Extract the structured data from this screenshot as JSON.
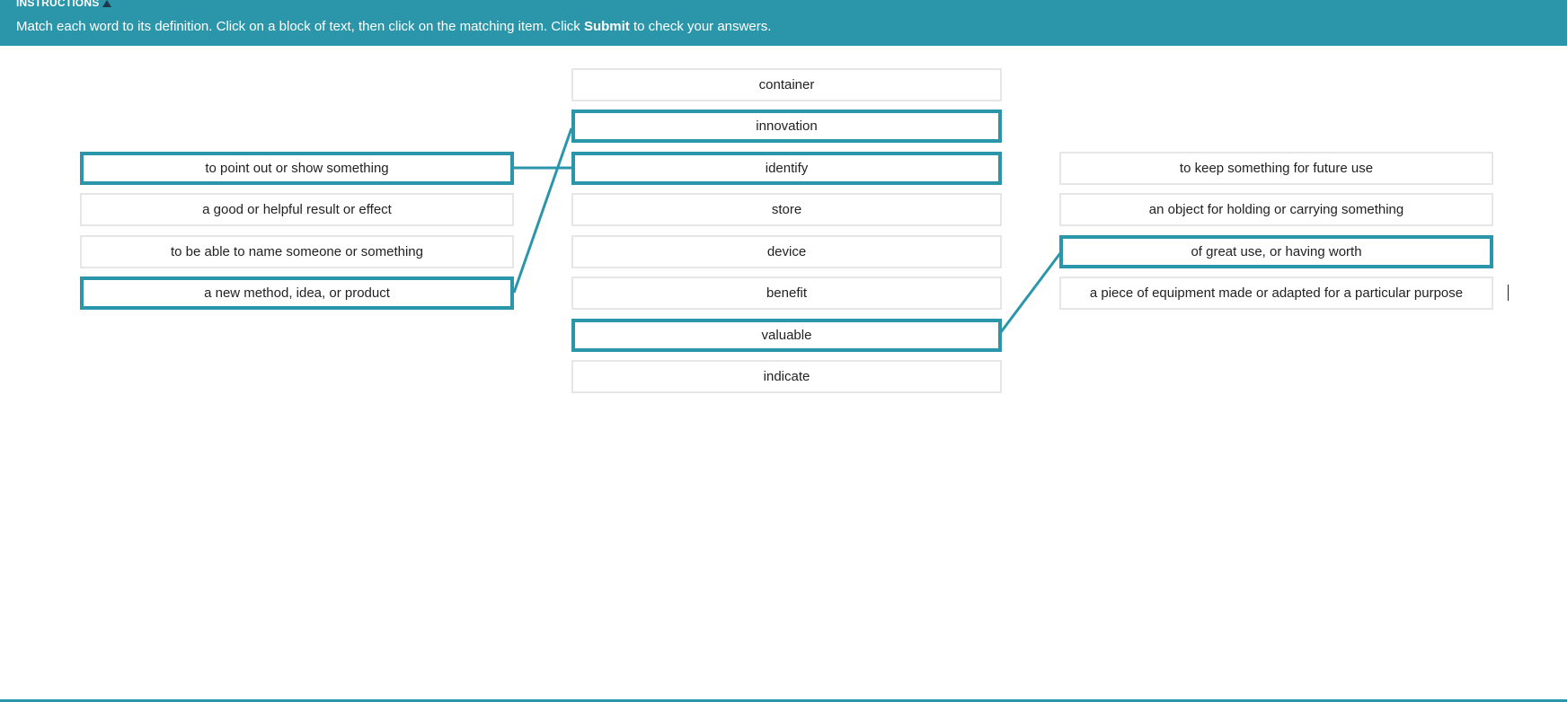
{
  "header": {
    "title": "INSTRUCTIONS",
    "toggle_icon": "triangle-up-icon",
    "instruction_before": "Match each word to its definition. Click on a block of text, then click on the matching item. Click ",
    "instruction_bold": "Submit",
    "instruction_after": " to check your answers."
  },
  "colors": {
    "accent": "#2b96a9",
    "box_border": "#e6e6e6",
    "toggle_icon": "#1b3a48"
  },
  "left_definitions": [
    {
      "text": "to point out or show something",
      "selected": true
    },
    {
      "text": "a good or helpful result or effect",
      "selected": false
    },
    {
      "text": "to be able to name someone or something",
      "selected": false
    },
    {
      "text": "a new method, idea, or product",
      "selected": true
    }
  ],
  "words": [
    {
      "text": "container",
      "selected": false
    },
    {
      "text": "innovation",
      "selected": true
    },
    {
      "text": "identify",
      "selected": true
    },
    {
      "text": "store",
      "selected": false
    },
    {
      "text": "device",
      "selected": false
    },
    {
      "text": "benefit",
      "selected": false
    },
    {
      "text": "valuable",
      "selected": true
    },
    {
      "text": "indicate",
      "selected": false
    }
  ],
  "right_definitions": [
    {
      "text": "to keep something for future use",
      "selected": false
    },
    {
      "text": "an object for holding or carrying something",
      "selected": false
    },
    {
      "text": "of great use, or having worth",
      "selected": true
    },
    {
      "text": "a piece of equipment made or adapted for a particular purpose",
      "selected": false
    }
  ],
  "matches": [
    {
      "definition": "to point out or show something",
      "word": "identify"
    },
    {
      "definition": "a new method, idea, or product",
      "word": "innovation"
    },
    {
      "definition": "of great use, or having worth",
      "word": "valuable"
    }
  ]
}
